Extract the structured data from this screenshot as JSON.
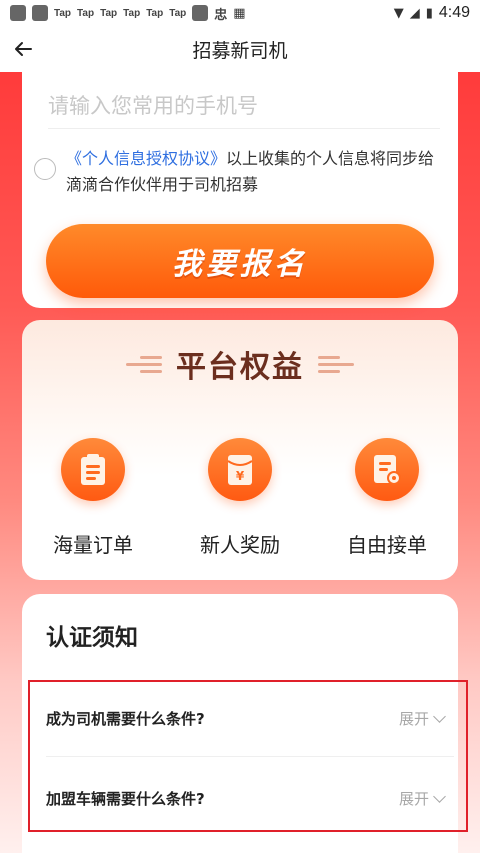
{
  "status_bar": {
    "tap_labels": [
      "Tap",
      "Tap",
      "Tap",
      "Tap",
      "Tap",
      "Tap"
    ],
    "badge": "忠",
    "time": "4:49"
  },
  "header": {
    "title": "招募新司机",
    "back_icon": "arrow-left-icon"
  },
  "form": {
    "phone_placeholder": "请输入您常用的手机号",
    "agreement_link": "《个人信息授权协议》",
    "agreement_text": "以上收集的个人信息将同步给滴滴合作伙伴用于司机招募",
    "signup_label": "我要报名"
  },
  "benefits": {
    "title": "平台权益",
    "items": [
      {
        "label": "海量订单",
        "icon": "clipboard-icon"
      },
      {
        "label": "新人奖励",
        "icon": "red-envelope-icon"
      },
      {
        "label": "自由接单",
        "icon": "order-document-icon"
      }
    ]
  },
  "notice": {
    "title": "认证须知",
    "faqs": [
      {
        "question": "成为司机需要什么条件?",
        "toggle": "展开"
      },
      {
        "question": "加盟车辆需要什么条件?",
        "toggle": "展开"
      }
    ]
  },
  "colors": {
    "accent_orange": "#ff5a0a",
    "link_blue": "#2f6fe0",
    "highlight_red": "#e0202a"
  }
}
